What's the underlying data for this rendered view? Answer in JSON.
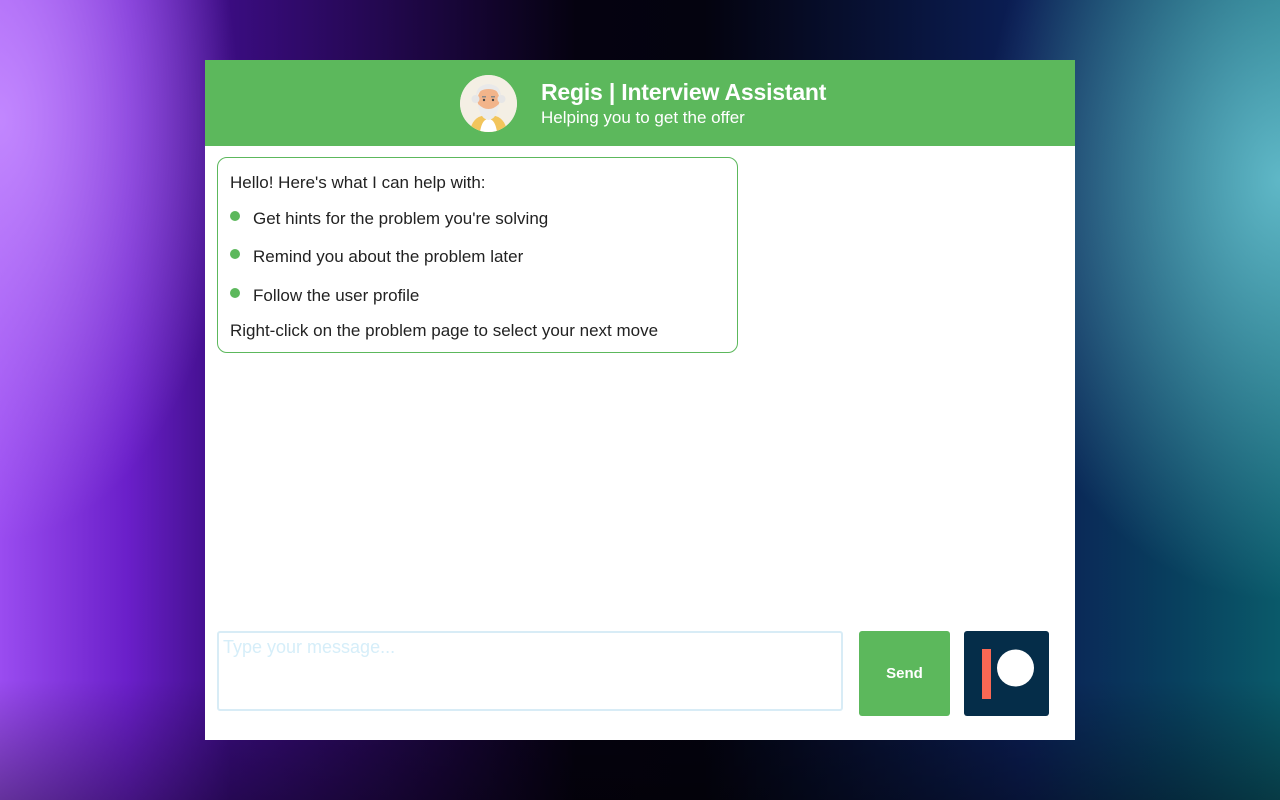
{
  "header": {
    "title": "Regis | Interview Assistant",
    "subtitle": "Helping you to get the offer",
    "avatar_icon": "old-man-avatar-icon"
  },
  "message": {
    "greeting": "Hello! Here's what I can help with:",
    "items": [
      "Get hints for the problem you're solving",
      "Remind you about the problem later",
      "Follow the user profile"
    ],
    "footer": "Right-click on the problem page to select your next move"
  },
  "composer": {
    "placeholder": "Type your message...",
    "send_label": "Send",
    "patreon_icon": "patreon-icon"
  },
  "colors": {
    "accent": "#5cb85c",
    "patreon_bg": "#052d49",
    "patreon_bar": "#f96854"
  }
}
